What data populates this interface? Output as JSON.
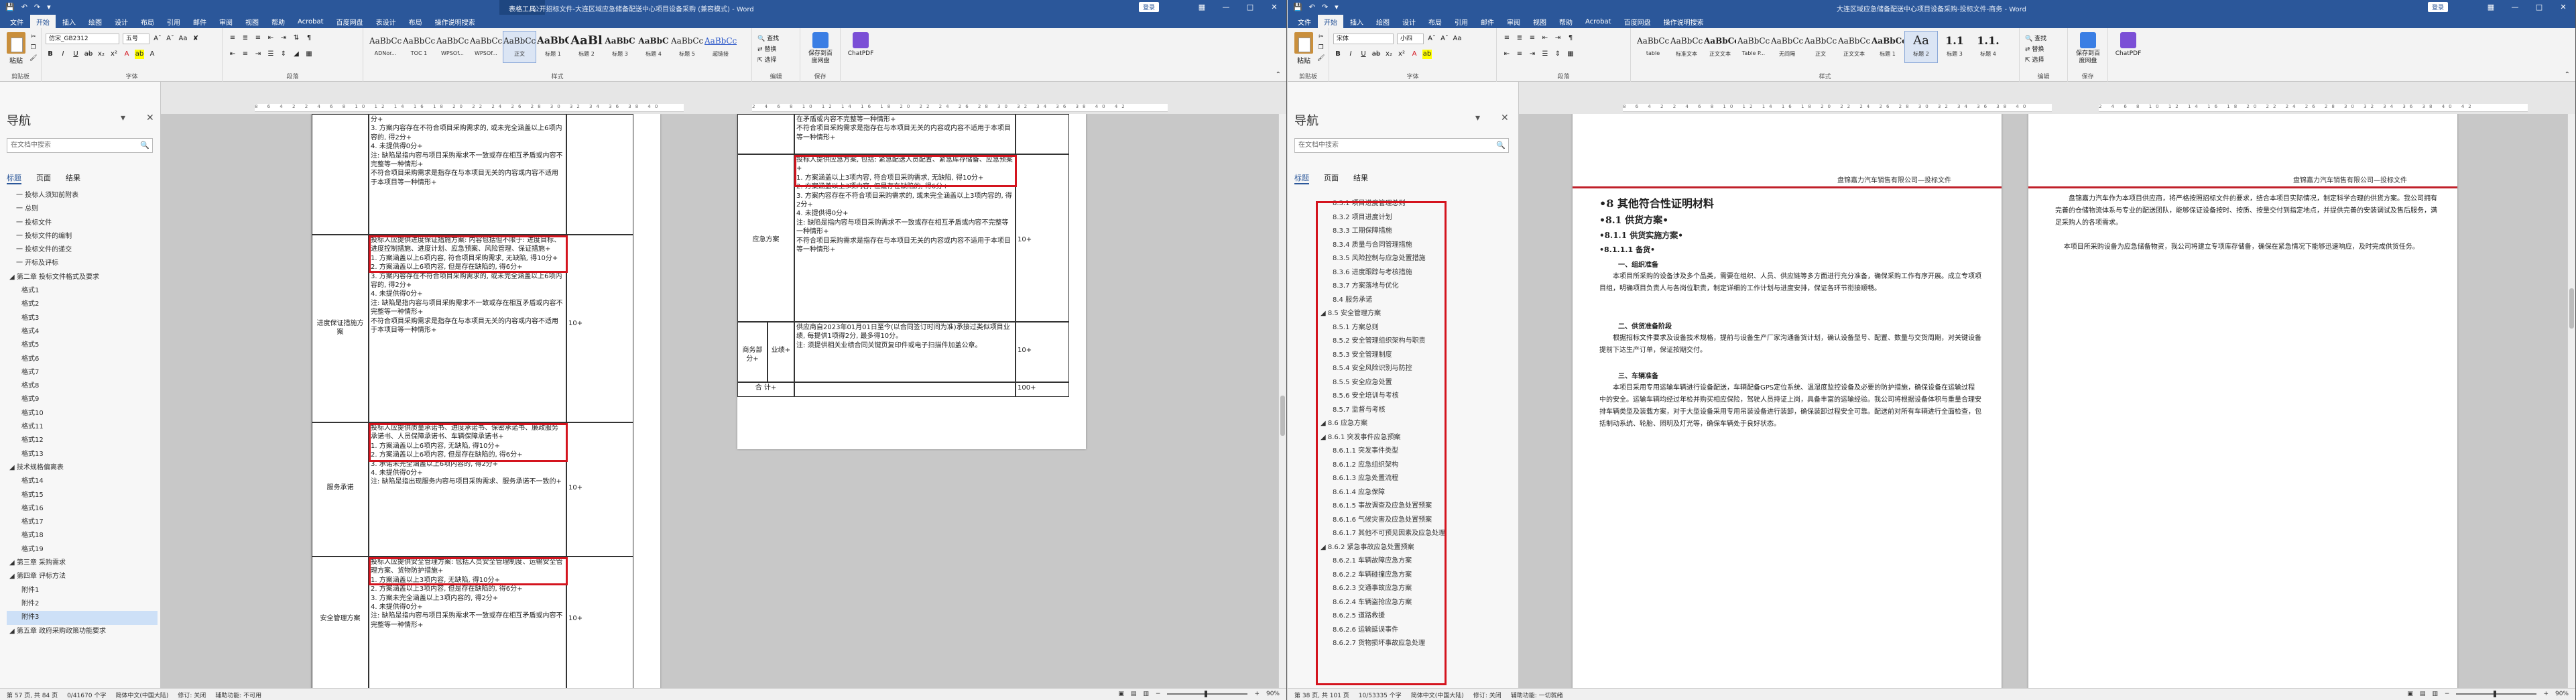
{
  "win1": {
    "title": "公开招标文件-大连区域应急储备配送中心项目设备采购 (兼容模式) - Word",
    "context_tab": "表格工具",
    "login": "登录",
    "tabs": [
      "文件",
      "开始",
      "插入",
      "绘图",
      "设计",
      "布局",
      "引用",
      "邮件",
      "审阅",
      "视图",
      "帮助",
      "Acrobat",
      "百度网盘",
      "表设计",
      "布局",
      "操作说明搜索"
    ],
    "active_tab": "开始",
    "clipboard": {
      "paste": "粘贴",
      "group": "剪贴板"
    },
    "font": {
      "name": "仿宋_GB2312",
      "size": "五号",
      "group": "字体"
    },
    "paragraph_group": "段落",
    "styles": [
      {
        "preview": "AaBbCcI",
        "name": "ADNor..."
      },
      {
        "preview": "AaBbCcDc",
        "name": "TOC 1"
      },
      {
        "preview": "AaBbCcI",
        "name": "WPSOf..."
      },
      {
        "preview": "AaBbCcI",
        "name": "WPSOf..."
      },
      {
        "preview": "AaBbCcDc",
        "name": "正文"
      },
      {
        "preview": "AaBbC",
        "name": "标题 1"
      },
      {
        "preview": "AaBl",
        "name": "标题 2"
      },
      {
        "preview": "AaBbC",
        "name": "标题 3"
      },
      {
        "preview": "AaBbC",
        "name": "标题 4"
      },
      {
        "preview": "AaBbCc",
        "name": "标题 5"
      },
      {
        "preview": "AaBbCcD",
        "name": "超链接"
      }
    ],
    "styles_group": "样式",
    "editing": {
      "find": "查找",
      "replace": "替换",
      "select": "选择",
      "group": "编辑"
    },
    "buttons": [
      {
        "label": "保存到百度网盘",
        "group": "保存"
      },
      {
        "label": "ChatPDF",
        "group": ""
      }
    ],
    "nav": {
      "title": "导航",
      "search_placeholder": "在文档中搜索",
      "tabs": [
        "标题",
        "页面",
        "结果"
      ],
      "items": [
        "一 投标人须知前附表",
        "一 总则",
        "一 投标文件",
        "一 投标文件的编制",
        "一 投标文件的递交",
        "一 开标及评标",
        "◢ 第二章 投标文件格式及要求",
        "格式1",
        "格式2",
        "格式3",
        "格式4",
        "格式5",
        "格式6",
        "格式7",
        "格式8",
        "格式9",
        "格式10",
        "格式11",
        "格式12",
        "格式13",
        "◢ 技术规格偏离表",
        "格式14",
        "格式15",
        "格式16",
        "格式17",
        "格式18",
        "格式19",
        "◢ 第三章 采购需求",
        "◢ 第四章 评标方法",
        "附件1",
        "附件2",
        "附件3",
        "◢ 第五章 政府采购政策功能要求"
      ],
      "selected_index": 31
    },
    "doc": {
      "left_rows": [
        {
          "category": "",
          "content": "分+\n3. 方案内容存在不符合项目采购需求的, 或未完全涵盖以上6项内容的, 得2分+\n4. 未提供得0分+\n注: 缺陷是指内容与项目采购需求不一致或存在相互矛盾或内容不完整等一种情形+\n不符合项目采购需求是指存在与本项目无关的内容或内容不适用于本项目等一种情形+",
          "score": ""
        },
        {
          "category": "进度保证措施方案",
          "content": "投标人应提供进度保证措施方案: 内容包括但不限于: 进度目标、进度控制措施、进度计划、应急预案、风险管理、保证措施+\n1. 方案涵盖以上6项内容, 符合项目采购需求, 无缺陷, 得10分+\n2. 方案涵盖以上6项内容, 但是存在缺陷的, 得6分+\n3. 方案内容存在不符合项目采购需求的, 或未完全涵盖以上6项内容的, 得2分+\n4. 未提供得0分+\n注: 缺陷是指内容与项目采购需求不一致或存在相互矛盾或内容不完整等一种情形+\n不符合项目采购需求是指存在与本项目无关的内容或内容不适用于本项目等一种情形+",
          "score": "10+"
        },
        {
          "category": "服务承诺",
          "content": "投标人应提供质量承诺书、进度承诺书、保密承诺书、廉政服务承诺书、人员保障承诺书、车辆保障承诺书+\n1. 方案涵盖以上6项内容, 无缺陷, 得10分+\n2. 方案涵盖以上6项内容, 但是存在缺陷的, 得6分+\n3. 承诺未完全涵盖以上6项内容的, 得2分+\n4. 未提供得0分+\n注: 缺陷是指出现服务内容与项目采购需求、服务承诺不一致的+",
          "score": "10+"
        },
        {
          "category": "安全管理方案",
          "content": "投标人应提供安全管理方案: 包括人员安全管理制度、运输安全管理方案、货物防护措施+\n1. 方案涵盖以上3项内容, 无缺陷, 得10分+\n2. 方案涵盖以上3项内容, 但是存在缺陷的, 得6分+\n3. 方案未完全涵盖以上3项内容的, 得2分+\n4. 未提供得0分+\n注: 缺陷是指内容与项目采购需求不一致或存在相互矛盾或内容不完整等一种情形+",
          "score": "10+"
        }
      ],
      "right_rows": [
        {
          "category": "",
          "content": "在矛盾或内容不完整等一种情形+\n不符合项目采购需求是指存在与本项目无关的内容或内容不适用于本项目等一种情形+",
          "score": ""
        },
        {
          "category": "应急方案",
          "content": "投标人提供应急方案, 包括: 紧急配送人员配置、紧急库存储备、应急预案+\n1. 方案涵盖以上3项内容, 符合项目采购需求, 无缺陷, 得10分+\n2. 方案涵盖以上3项内容, 但是存在缺陷的, 得6分+\n3. 方案内容存在不符合项目采购需求的, 或未完全涵盖以上3项内容的, 得2分+\n4. 未提供得0分+\n注: 缺陷是指内容与项目采购需求不一致或存在相互矛盾或内容不完整等一种情形+\n不符合项目采购需求是指存在与本项目无关的内容或内容不适用于本项目等一种情形+",
          "score": "10+"
        },
        {
          "category": "商务部分+",
          "sub": "业绩+",
          "content": "供应商自2023年01月01日至今(以合同签订时间为准)承接过类似项目业绩, 每提供1项得2分, 最多得10分。\n注: 须提供相关业绩合同关键页复印件或电子扫描件加盖公章。",
          "score": "10+"
        },
        {
          "category": "合 计+",
          "sub": "",
          "content": "",
          "score": "100+"
        }
      ]
    },
    "status": {
      "page": "第 57 页, 共 84 页",
      "words": "0/41670 个字",
      "lang": "简体中文(中国大陆)",
      "track": "修订: 关闭",
      "access": "辅助功能: 不可用",
      "zoom": "90%"
    }
  },
  "win2": {
    "title": "大连区域应急储备配送中心项目设备采购-投标文件-商务 - Word",
    "login": "登录",
    "tabs": [
      "文件",
      "开始",
      "插入",
      "绘图",
      "设计",
      "布局",
      "引用",
      "邮件",
      "审阅",
      "视图",
      "帮助",
      "Acrobat",
      "百度网盘",
      "操作说明搜索"
    ],
    "active_tab": "开始",
    "font": {
      "name": "宋体",
      "size": "小四"
    },
    "styles": [
      {
        "preview": "AaBbCcD",
        "name": "table"
      },
      {
        "preview": "AaBbCcDc",
        "name": "标准文本"
      },
      {
        "preview": "AaBbCcD",
        "name": "正文文本"
      },
      {
        "preview": "AaBbCcD",
        "name": "Table P..."
      },
      {
        "preview": "AaBbCcD",
        "name": "无间隔"
      },
      {
        "preview": "AaBbCcD",
        "name": "正文"
      },
      {
        "preview": "AaBbCcD",
        "name": "正文文本"
      },
      {
        "preview": "AaBbCc",
        "name": "标题 1"
      },
      {
        "preview": "Aa",
        "name": "标题 2"
      },
      {
        "preview": "1.1",
        "name": "标题 3"
      },
      {
        "preview": "1.1.",
        "name": "标题 4"
      }
    ],
    "nav": {
      "title": "导航",
      "search_placeholder": "在文档中搜索",
      "tabs": [
        "标题",
        "页面",
        "结果"
      ],
      "items": [
        "8.3.1 项目进度管理总则",
        "8.3.2 项目进度计划",
        "8.3.3 工期保障措施",
        "8.3.4 质量与合同管理措施",
        "8.3.5 风险控制与应急处置措施",
        "8.3.6 进度跟踪与考核措施",
        "8.3.7 方案落地与优化",
        "8.4 服务承诺",
        "◢ 8.5 安全管理方案",
        "8.5.1 方案总则",
        "8.5.2 安全管理组织架构与职责",
        "8.5.3 安全管理制度",
        "8.5.4 安全风险识别与防控",
        "8.5.5 安全应急处置",
        "8.5.6 安全培训与考核",
        "8.5.7 监督与考核",
        "◢ 8.6 应急方案",
        "◢ 8.6.1 突发事件应急预案",
        "8.6.1.1 突发事件类型",
        "8.6.1.2 应急组织架构",
        "8.6.1.3 应急处置流程",
        "8.6.1.4 应急保障",
        "8.6.1.5 事故调查及应急处置预案",
        "8.6.1.6 气候灾害及应急处置预案",
        "8.6.1.7 其他不可预见因素及应急处理",
        "◢ 8.6.2 紧急事故应急处置预案",
        "8.6.2.1 车辆故障应急方案",
        "8.6.2.2 车辆碰撞应急方案",
        "8.6.2.3 交通事故应急方案",
        "8.6.2.4 车辆盗抢应急方案",
        "8.6.2.5 道路救援",
        "8.6.2.6 运输延误事件",
        "8.6.2.7 货物损坏事故应急处理"
      ]
    },
    "doc": {
      "header_company": "盘锦嘉力汽车销售有限公司—投标文件",
      "h1": "•8   其他符合性证明材料",
      "h2": "•8.1   供货方案•",
      "h3": "•8.1.1  供货实施方案•",
      "h4": "•8.1.1.1  备货•",
      "s1": "一、组织准备",
      "p1": "本项目所采购的设备涉及多个品类，需要在组织、人员、供应链等多方面进行充分准备，确保采购工作有序开展。成立专项项目组，明确项目负责人与各岗位职责，制定详细的工作计划与进度安排，保证各环节衔接顺畅。",
      "s2": "二、供货准备阶段",
      "p2": "根据招标文件要求及设备技术规格，提前与设备生产厂家沟通备货计划，确认设备型号、配置、数量与交货周期，对关键设备提前下达生产订单，保证按期交付。",
      "s3": "三、车辆准备",
      "p3": "本项目采用专用运输车辆进行设备配送，车辆配备GPS定位系统、温湿度监控设备及必要的防护措施，确保设备在运输过程中的安全。运输车辆均经过年检并购买相应保险，驾驶人员持证上岗，具备丰富的运输经验。我公司将根据设备体积与重量合理安排车辆类型及装载方案，对于大型设备采用专用吊装设备进行装卸，确保装卸过程安全可靠。配送前对所有车辆进行全面检查，包括制动系统、轮胎、照明及灯光等，确保车辆处于良好状态。",
      "right_p": "盘锦嘉力汽车作为本项目供应商，将严格按照招标文件的要求，结合本项目实际情况，制定科学合理的供货方案。我公司拥有完善的仓储物流体系与专业的配送团队，能够保证设备按时、按质、按量交付到指定地点，并提供完善的安装调试及售后服务，满足采购人的各项需求。\n\n    本项目所采购设备为应急储备物资，我公司将建立专项库存储备，确保在紧急情况下能够迅速响应，及时完成供货任务。"
    },
    "status": {
      "page": "第 38 页, 共 101 页",
      "words": "10/53335 个字",
      "lang": "简体中文(中国大陆)",
      "track": "修订: 关闭",
      "access": "辅助功能: 一切就绪",
      "zoom": "90%"
    }
  }
}
